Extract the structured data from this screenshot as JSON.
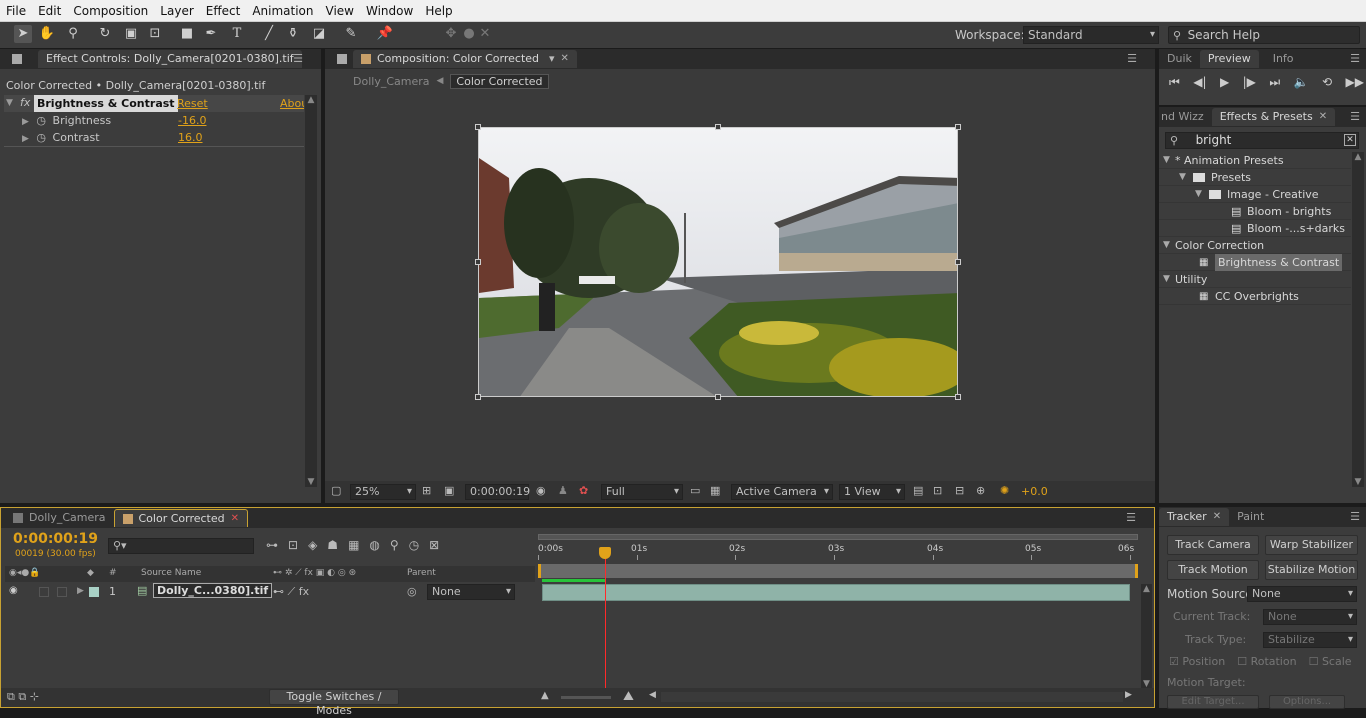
{
  "menubar": [
    "File",
    "Edit",
    "Composition",
    "Layer",
    "Effect",
    "Animation",
    "View",
    "Window",
    "Help"
  ],
  "toolbar": {
    "workspace_label": "Workspace:",
    "workspace_value": "Standard",
    "search_placeholder": "Search Help"
  },
  "effect_controls": {
    "tab_label": "Effect Controls: Dolly_Camera[0201-0380].tif",
    "subtitle": "Color Corrected • Dolly_Camera[0201-0380].tif",
    "effect_name": "Brightness & Contrast",
    "reset": "Reset",
    "about": "About",
    "params": [
      {
        "name": "Brightness",
        "value": "-16.0"
      },
      {
        "name": "Contrast",
        "value": "16.0"
      }
    ]
  },
  "composition": {
    "tab_label": "Composition: Color Corrected",
    "breadcrumbs": [
      "Dolly_Camera",
      "Color Corrected"
    ],
    "zoom": "25%",
    "timecode": "0:00:00:19",
    "resolution": "Full",
    "camera": "Active Camera",
    "views": "1 View",
    "exposure": "+0.0"
  },
  "right_top": {
    "tabs": [
      "Duik",
      "Preview",
      "Info"
    ]
  },
  "effects_presets": {
    "tabs": [
      "nd Wizz",
      "Effects & Presets"
    ],
    "search_value": "bright",
    "tree": [
      {
        "label": "* Animation Presets",
        "level": 0,
        "kind": "group"
      },
      {
        "label": "Presets",
        "level": 1,
        "kind": "folder"
      },
      {
        "label": "Image - Creative",
        "level": 2,
        "kind": "folder"
      },
      {
        "label": "Bloom - brights",
        "level": 3,
        "kind": "preset"
      },
      {
        "label": "Bloom -...s+darks",
        "level": 3,
        "kind": "preset"
      },
      {
        "label": "Color Correction",
        "level": 0,
        "kind": "group"
      },
      {
        "label": "Brightness & Contrast",
        "level": 1,
        "kind": "effect",
        "selected": true
      },
      {
        "label": "Utility",
        "level": 0,
        "kind": "group"
      },
      {
        "label": "CC Overbrights",
        "level": 1,
        "kind": "effect"
      }
    ]
  },
  "timeline": {
    "tabs": [
      "Dolly_Camera",
      "Color Corrected"
    ],
    "timecode": "0:00:00:19",
    "fps_info": "00019 (30.00 fps)",
    "columns": {
      "num": "#",
      "source": "Source Name",
      "parent": "Parent"
    },
    "layer": {
      "index": "1",
      "name": "Dolly_C...0380].tif",
      "parent": "None"
    },
    "ruler": [
      "0:00s",
      "01s",
      "02s",
      "03s",
      "04s",
      "05s",
      "06s"
    ],
    "toggle_label": "Toggle Switches / Modes"
  },
  "tracker": {
    "tabs": [
      "Tracker",
      "Paint"
    ],
    "buttons": [
      "Track Camera",
      "Warp Stabilizer",
      "Track Motion",
      "Stabilize Motion"
    ],
    "motion_source_label": "Motion Source:",
    "motion_source_value": "None",
    "current_track_label": "Current Track:",
    "current_track_value": "None",
    "track_type_label": "Track Type:",
    "track_type_value": "Stabilize",
    "checks": [
      "Position",
      "Rotation",
      "Scale"
    ],
    "motion_target_label": "Motion Target:",
    "edit_target": "Edit Target...",
    "options": "Options..."
  },
  "colors": {
    "accent": "#e0a21a",
    "panel": "#3c3c3c",
    "selection": "#6a6a6a",
    "playhead": "#ff2a2a"
  }
}
